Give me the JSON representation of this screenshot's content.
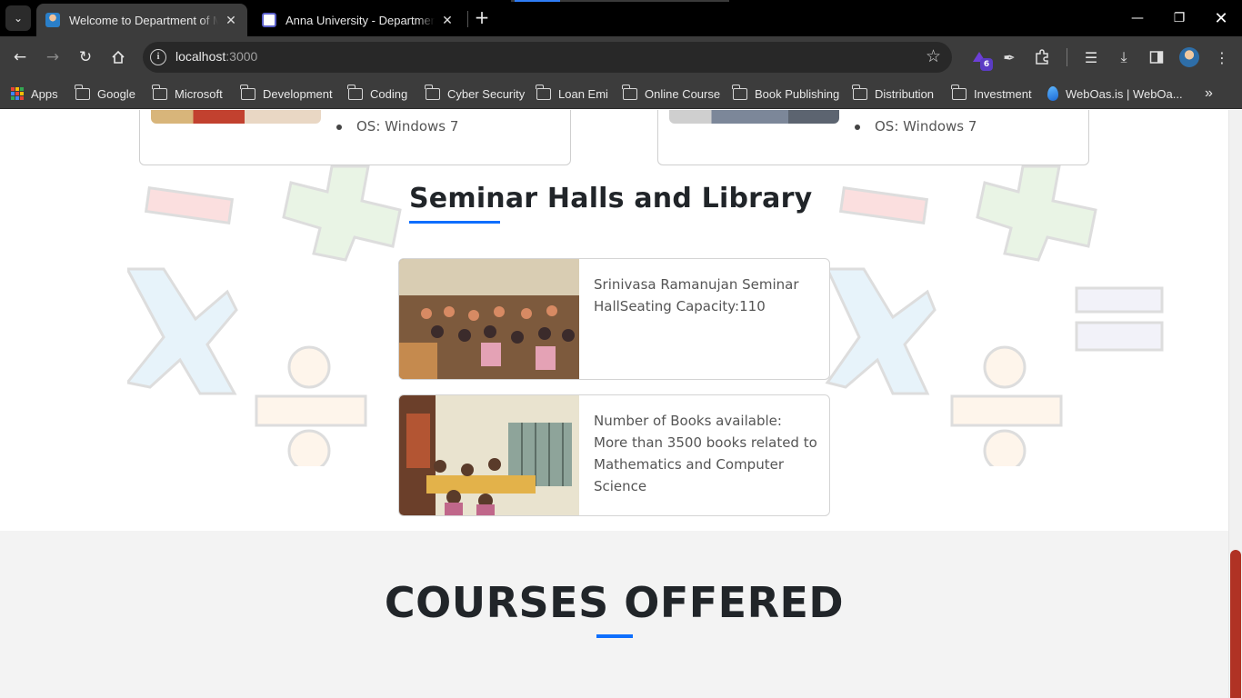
{
  "browser": {
    "tabs": [
      {
        "title": "Welcome to Department of Mathematics",
        "active": true
      },
      {
        "title": "Anna University - Department of Mathematics",
        "active": false
      }
    ],
    "url_host": "localhost",
    "url_port": ":3000",
    "extension_badge": "6",
    "bookmarks": [
      {
        "label": "Apps",
        "icon": "apps-grid-icon"
      },
      {
        "label": "Google",
        "icon": "folder-icon"
      },
      {
        "label": "Microsoft",
        "icon": "folder-icon"
      },
      {
        "label": "Development",
        "icon": "folder-icon"
      },
      {
        "label": "Coding",
        "icon": "folder-icon"
      },
      {
        "label": "Cyber Security",
        "icon": "folder-icon"
      },
      {
        "label": "Loan Emi",
        "icon": "folder-icon"
      },
      {
        "label": "Online Course",
        "icon": "folder-icon"
      },
      {
        "label": "Book Publishing",
        "icon": "folder-icon"
      },
      {
        "label": "Distribution",
        "icon": "folder-icon"
      },
      {
        "label": "Investment",
        "icon": "folder-icon"
      },
      {
        "label": "WebOas.is | WebOa...",
        "icon": "weboasis-icon"
      }
    ]
  },
  "page": {
    "lab_cards": [
      {
        "spec": "OS: Windows 7"
      },
      {
        "spec": "OS: Windows 7"
      }
    ],
    "seminar_section": {
      "title": "Seminar Halls and Library",
      "cards": [
        {
          "text": "Srinivasa Ramanujan Seminar HallSeating Capacity:110"
        },
        {
          "text": "Number of Books available: More than 3500 books related to Mathematics and Computer Science"
        }
      ]
    },
    "courses_section": {
      "title": "COURSES OFFERED"
    }
  },
  "colors": {
    "accent": "#0d6efd",
    "scroll_thumb": "#b03224",
    "chrome_dark": "#3c3c3c"
  }
}
